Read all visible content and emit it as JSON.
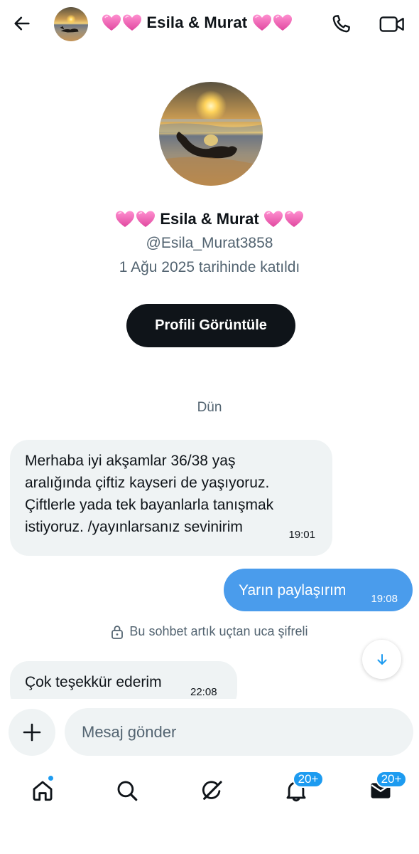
{
  "header": {
    "title": "Esila & Murat",
    "avatar_alt": "profile-photo"
  },
  "profile": {
    "name": "Esila & Murat",
    "handle": "@Esila_Murat3858",
    "joined": "1 Ağu 2025 tarihinde katıldı",
    "view_button": "Profili Görüntüle"
  },
  "conversation": {
    "day_label": "Dün",
    "messages": [
      {
        "direction": "incoming",
        "lines": [
          "Merhaba iyi akşamlar 36/38 yaş",
          "aralığında çiftiz kayseri de yaşıyoruz.",
          "Çiftlerle yada tek bayanlarla tanışmak",
          "istiyoruz. /yayınlarsanız sevinirim"
        ],
        "time": "19:01"
      },
      {
        "direction": "outgoing",
        "text": "Yarın paylaşırım",
        "time": "19:08"
      },
      {
        "direction": "incoming",
        "text": "Çok teşekkür ederim",
        "time": "22:08"
      }
    ],
    "encryption_note": "Bu sohbet artık uçtan uca şifreli"
  },
  "composer": {
    "placeholder": "Mesaj gönder"
  },
  "nav": {
    "items": [
      {
        "icon": "home-icon",
        "badge": ""
      },
      {
        "icon": "search-icon",
        "badge": ""
      },
      {
        "icon": "grok-icon",
        "badge": ""
      },
      {
        "icon": "bell-icon",
        "badge": "20+"
      },
      {
        "icon": "mail-icon",
        "badge": "20+"
      }
    ]
  },
  "colors": {
    "accent": "#1d9bf0",
    "outgoing_bubble": "#4a9cec",
    "incoming_bubble": "#eff3f4",
    "heart": "#f06ab8"
  }
}
